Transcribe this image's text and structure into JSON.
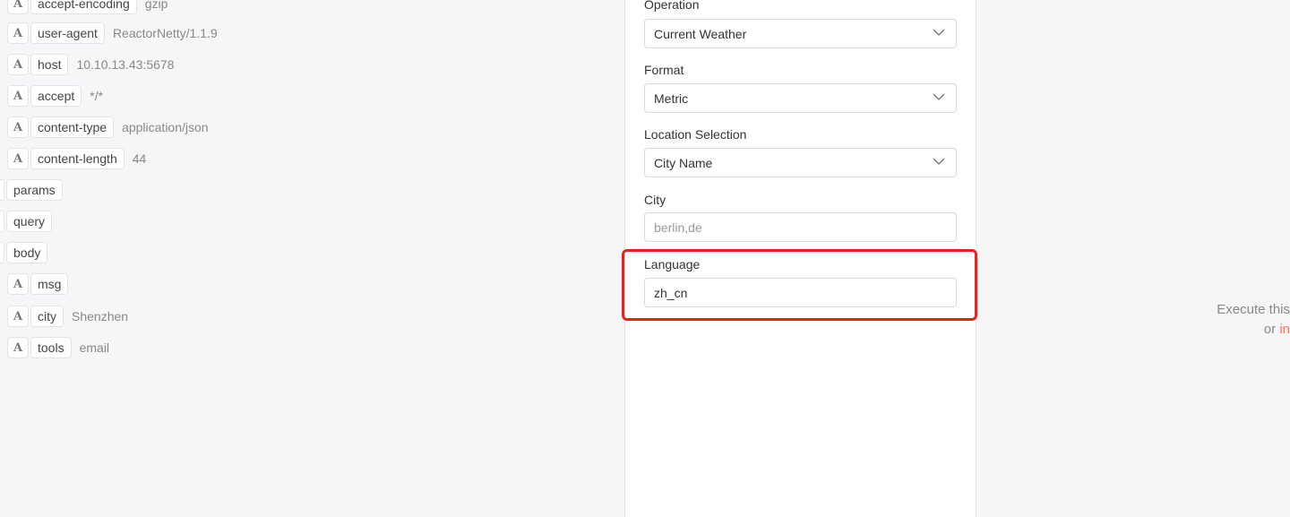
{
  "input_panel": {
    "items": [
      {
        "type": "string",
        "icon": "A",
        "key": "accept-encoding",
        "value": "gzip"
      },
      {
        "type": "string",
        "icon": "A",
        "key": "user-agent",
        "value": "ReactorNetty/1.1.9"
      },
      {
        "type": "string",
        "icon": "A",
        "key": "host",
        "value": "10.10.13.43:5678"
      },
      {
        "type": "string",
        "icon": "A",
        "key": "accept",
        "value": "*/*"
      },
      {
        "type": "string",
        "icon": "A",
        "key": "content-type",
        "value": "application/json"
      },
      {
        "type": "string",
        "icon": "A",
        "key": "content-length",
        "value": "44"
      },
      {
        "type": "object",
        "icon": "",
        "key": "params",
        "value": ""
      },
      {
        "type": "object",
        "icon": "",
        "key": "query",
        "value": ""
      },
      {
        "type": "object",
        "icon": "",
        "key": "body",
        "value": ""
      },
      {
        "type": "string",
        "icon": "A",
        "key": "msg",
        "value": ""
      },
      {
        "type": "string",
        "icon": "A",
        "key": "city",
        "value": "Shenzhen"
      },
      {
        "type": "string",
        "icon": "A",
        "key": "tools",
        "value": "email"
      }
    ]
  },
  "params": {
    "operation": {
      "label": "Operation",
      "value": "Current Weather"
    },
    "format": {
      "label": "Format",
      "value": "Metric"
    },
    "location_selection": {
      "label": "Location Selection",
      "value": "City Name"
    },
    "city": {
      "label": "City",
      "placeholder": "berlin,de",
      "value": ""
    },
    "language": {
      "label": "Language",
      "value": "zh_cn"
    }
  },
  "output_hint": {
    "line1": "Execute this",
    "line2_prefix": "or ",
    "line2_link": "in"
  },
  "colors": {
    "highlight": "#e8231c",
    "link": "#ff6d5a"
  }
}
